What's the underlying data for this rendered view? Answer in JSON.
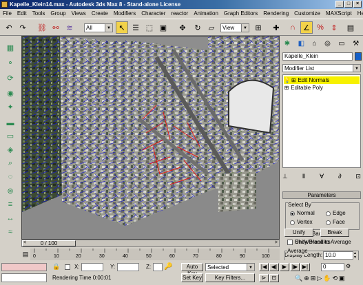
{
  "window": {
    "title": "Kapelle_Klein14.max - Autodesk 3ds Max 8 - Stand-alone License",
    "controls": [
      "_",
      "□",
      "×"
    ]
  },
  "menu": [
    "File",
    "Edit",
    "Tools",
    "Group",
    "Views",
    "Create",
    "Modifiers",
    "Character",
    "reactor",
    "Animation",
    "Graph Editors",
    "Rendering",
    "Customize",
    "MAXScript",
    "Help"
  ],
  "toolbar": {
    "selection_filter": "All",
    "ref_coord": "View",
    "icons": [
      "undo-icon",
      "redo-icon",
      "link-icon",
      "unlink-icon",
      "bind-spacewarp-icon",
      "select-icon",
      "select-by-name-icon",
      "rect-region-icon",
      "window-crossing-icon",
      "move-icon",
      "rotate-icon",
      "scale-icon",
      "pivot-icon",
      "manipulate-icon",
      "snap-3d-icon",
      "angle-snap-icon",
      "percent-snap-icon",
      "spinner-snap-icon"
    ]
  },
  "left_toolbar": {
    "icons": [
      "create-icon",
      "modify-icon",
      "hierarchy-icon",
      "motion-icon",
      "display-icon",
      "utilities-icon",
      "box-icon",
      "sphere-icon",
      "cylinder-icon",
      "cone-icon",
      "torus-icon",
      "tube-icon",
      "plane-icon",
      "geosphere-icon",
      "pyramid-icon",
      "teapot-icon"
    ]
  },
  "viewport": {
    "description_label": "Perspective"
  },
  "command_panel": {
    "tabs": [
      "create-tab",
      "modify-tab",
      "hierarchy-tab",
      "motion-tab",
      "display-tab",
      "utilities-tab"
    ],
    "object_name": "Kapelle_Klein",
    "object_color": "#1560c8",
    "modifier_list": "Modifier List",
    "stack": [
      {
        "label": "Edit Normals",
        "selected": true
      },
      {
        "label": "Editable Poly",
        "selected": false
      }
    ],
    "parameters": {
      "title": "Parameters",
      "select_by": "Select By",
      "normal": "Normal",
      "edge": "Edge",
      "vertex": "Vertex",
      "face": "Face",
      "ignore_backfacing": "Ignore Backfacing",
      "show_handles": "Show Handles",
      "display_length_label": "Display Length:",
      "display_length_value": "10.0",
      "unify": "Unify",
      "break": "Break",
      "unify_break_avg": "Unify/Break to Average",
      "average": "Average"
    }
  },
  "time": {
    "slider_label": "0 / 100",
    "ticks": [
      "0",
      "10",
      "20",
      "30",
      "40",
      "50",
      "60",
      "70",
      "80",
      "90",
      "100"
    ]
  },
  "status": {
    "x_label": "X:",
    "y_label": "Y:",
    "z_label": "Z:",
    "rendering_time": "Rendering Time  0:00:01",
    "auto_key": "Auto Key",
    "set_key": "Set Key",
    "selected": "Selected",
    "key_filters": "Key Filters...",
    "frame": "0"
  }
}
